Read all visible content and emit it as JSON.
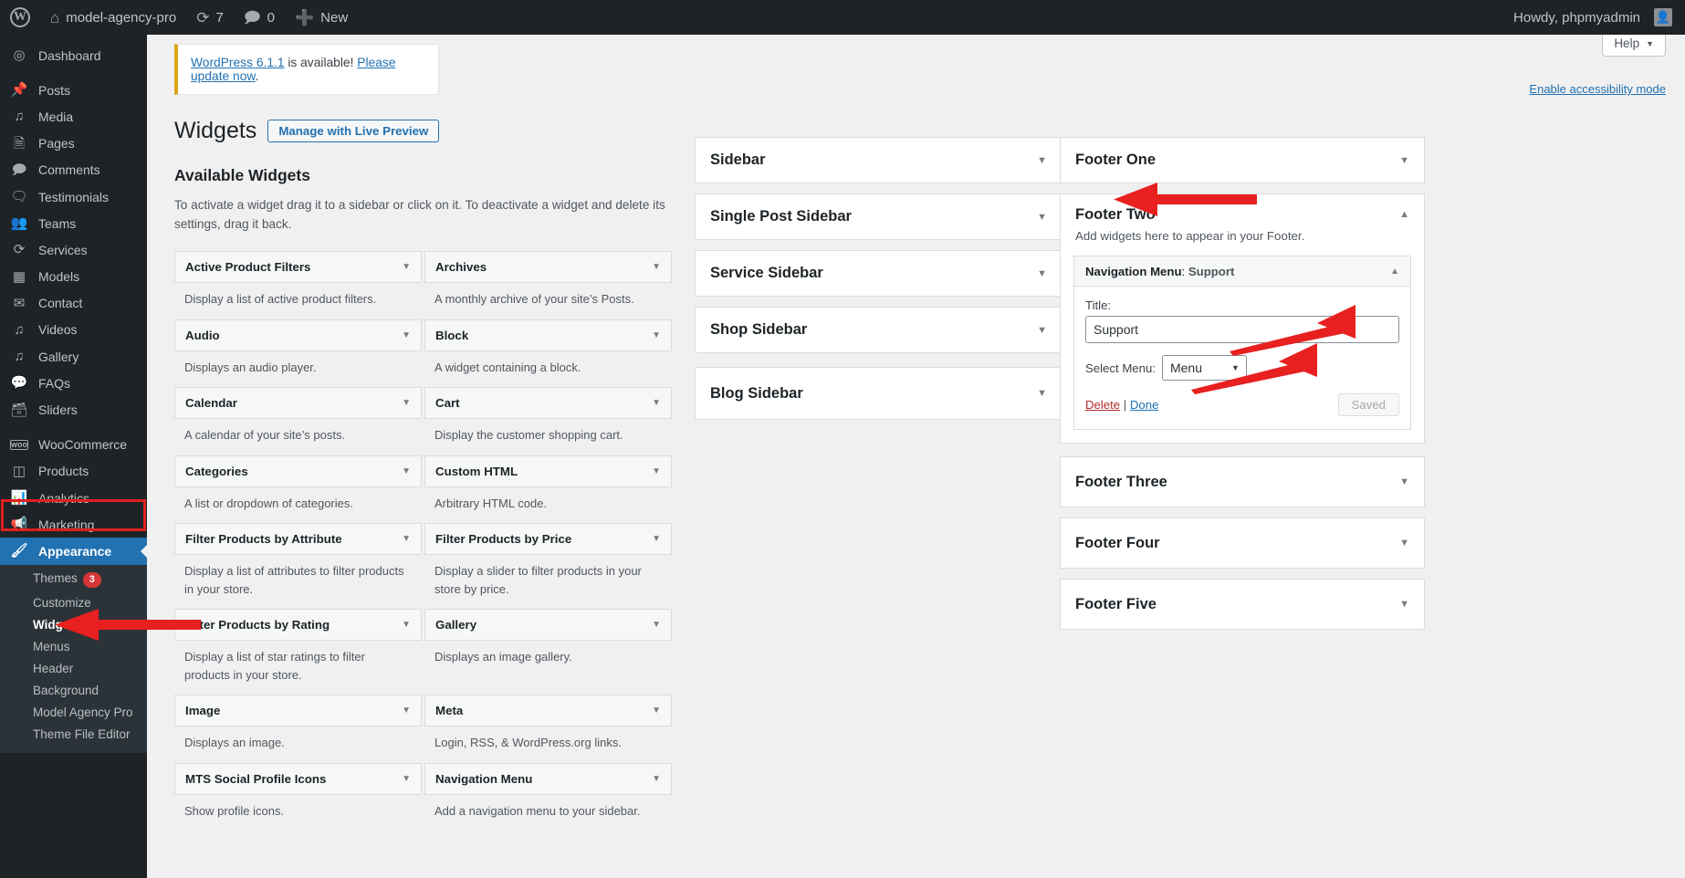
{
  "adminbar": {
    "logo_icon": "wordpress-logo-icon",
    "site_name": "model-agency-pro",
    "updates_icon": "update-icon",
    "updates_count": "7",
    "comments_icon": "comment-icon",
    "comments_count": "0",
    "new_icon": "plus-icon",
    "new_label": "New",
    "howdy": "Howdy, phpmyadmin"
  },
  "adminmenu": {
    "items": [
      {
        "label": "Dashboard",
        "icon": "dashboard-icon"
      },
      {
        "label": "Posts",
        "icon": "pin-icon"
      },
      {
        "label": "Media",
        "icon": "media-icon"
      },
      {
        "label": "Pages",
        "icon": "pages-icon"
      },
      {
        "label": "Comments",
        "icon": "comment-icon"
      },
      {
        "label": "Testimonials",
        "icon": "testimonials-icon"
      },
      {
        "label": "Teams",
        "icon": "teams-icon"
      },
      {
        "label": "Services",
        "icon": "services-icon"
      },
      {
        "label": "Models",
        "icon": "models-icon"
      },
      {
        "label": "Contact",
        "icon": "mail-icon"
      },
      {
        "label": "Videos",
        "icon": "video-icon"
      },
      {
        "label": "Gallery",
        "icon": "gallery-icon"
      },
      {
        "label": "FAQs",
        "icon": "faq-icon"
      },
      {
        "label": "Sliders",
        "icon": "sliders-icon"
      },
      {
        "label": "WooCommerce",
        "icon": "woocommerce-icon"
      },
      {
        "label": "Products",
        "icon": "products-icon"
      },
      {
        "label": "Analytics",
        "icon": "analytics-icon"
      },
      {
        "label": "Marketing",
        "icon": "marketing-icon"
      },
      {
        "label": "Appearance",
        "icon": "appearance-icon"
      }
    ],
    "appearance_submenu": [
      {
        "label": "Themes",
        "badge": "3"
      },
      {
        "label": "Customize",
        "badge": ""
      },
      {
        "label": "Widgets",
        "badge": ""
      },
      {
        "label": "Menus",
        "badge": ""
      },
      {
        "label": "Header",
        "badge": ""
      },
      {
        "label": "Background",
        "badge": ""
      },
      {
        "label": "Model Agency Pro",
        "badge": ""
      },
      {
        "label": "Theme File Editor",
        "badge": ""
      }
    ]
  },
  "header": {
    "help_label": "Help",
    "accessibility_link": "Enable accessibility mode",
    "update_notice_link1": "WordPress 6.1.1",
    "update_notice_mid": " is available! ",
    "update_notice_link2": "Please update now",
    "update_notice_end": ".",
    "page_title": "Widgets",
    "live_preview_button": "Manage with Live Preview"
  },
  "available": {
    "heading": "Available Widgets",
    "description": "To activate a widget drag it to a sidebar or click on it. To deactivate a widget and delete its settings, drag it back.",
    "widgets": [
      {
        "name": "Active Product Filters",
        "desc": "Display a list of active product filters."
      },
      {
        "name": "Archives",
        "desc": "A monthly archive of your site’s Posts."
      },
      {
        "name": "Audio",
        "desc": "Displays an audio player."
      },
      {
        "name": "Block",
        "desc": "A widget containing a block."
      },
      {
        "name": "Calendar",
        "desc": "A calendar of your site’s posts."
      },
      {
        "name": "Cart",
        "desc": "Display the customer shopping cart."
      },
      {
        "name": "Categories",
        "desc": "A list or dropdown of categories."
      },
      {
        "name": "Custom HTML",
        "desc": "Arbitrary HTML code."
      },
      {
        "name": "Filter Products by Attribute",
        "desc": "Display a list of attributes to filter products in your store."
      },
      {
        "name": "Filter Products by Price",
        "desc": "Display a slider to filter products in your store by price."
      },
      {
        "name": "Filter Products by Rating",
        "desc": "Display a list of star ratings to filter products in your store."
      },
      {
        "name": "Gallery",
        "desc": "Displays an image gallery."
      },
      {
        "name": "Image",
        "desc": "Displays an image."
      },
      {
        "name": "Meta",
        "desc": "Login, RSS, & WordPress.org links."
      },
      {
        "name": "MTS Social Profile Icons",
        "desc": "Show profile icons."
      },
      {
        "name": "Navigation Menu",
        "desc": "Add a navigation menu to your sidebar."
      }
    ]
  },
  "sidebars": [
    {
      "title": "Sidebar"
    },
    {
      "title": "Single Post Sidebar"
    },
    {
      "title": "Service Sidebar"
    },
    {
      "title": "Shop Sidebar"
    },
    {
      "title": "Blog Sidebar"
    }
  ],
  "footers": {
    "footer_one": {
      "title": "Footer One"
    },
    "footer_two": {
      "title": "Footer Two",
      "description": "Add widgets here to appear in your Footer.",
      "widget": {
        "type_label": "Navigation Menu",
        "separator": ": ",
        "instance_title": "Support",
        "title_label": "Title:",
        "title_value": "Support",
        "select_menu_label": "Select Menu:",
        "selected_menu": "Menu",
        "delete_label": "Delete",
        "pipe": " | ",
        "done_label": "Done",
        "saved_label": "Saved"
      }
    },
    "footer_three": {
      "title": "Footer Three"
    },
    "footer_four": {
      "title": "Footer Four"
    },
    "footer_five": {
      "title": "Footer Five"
    }
  },
  "colors": {
    "annotation_red": "#e02020",
    "admin_blue": "#2271b1",
    "admin_dark": "#1d2327"
  }
}
